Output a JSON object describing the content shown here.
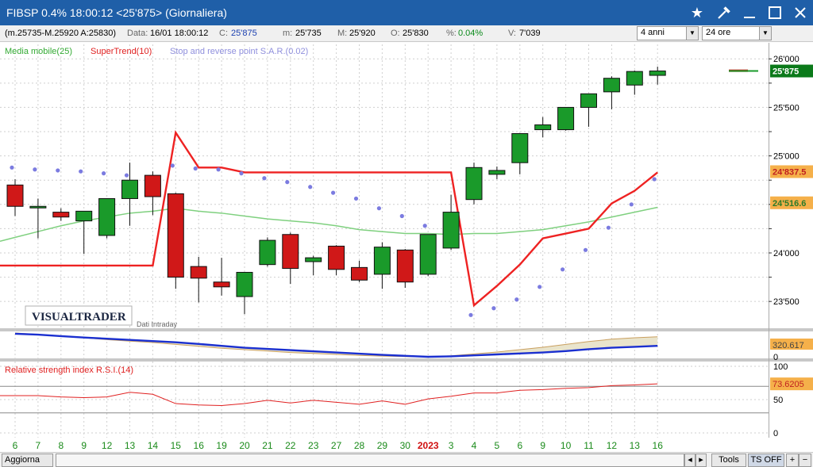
{
  "window": {
    "title": "FIBSP 0.4% 18:00:12  <25'875> (Giornaliera)",
    "icons": [
      "star-icon",
      "tools-icon",
      "minimize-icon",
      "maximize-icon",
      "close-icon"
    ]
  },
  "infobar": {
    "range": "(m.25735-M.25920 A:25830)",
    "data_label": "Data:",
    "data_value": "16/01 18:00:12",
    "close_label": "C:",
    "close_value": "25'875",
    "min_label": "m:",
    "min_value": "25'735",
    "max_label": "M:",
    "max_value": "25'920",
    "open_label": "O:",
    "open_value": "25'830",
    "pct_label": "%:",
    "pct_value": "0.04%",
    "vol_label": "V:",
    "vol_value": "7'039",
    "period_select": "4 anni",
    "interval_select": "24 ore"
  },
  "legend": {
    "ma": "Media mobile(25)",
    "supertrend": "SuperTrend(10)",
    "sar": "Stop and reverse point S.A.R.(0.02)"
  },
  "watermark": {
    "logo": "VISUALTRADER",
    "note": "Dati Intraday"
  },
  "colors": {
    "up": "#1a9a2a",
    "down": "#d01818",
    "ma": "#7fd07f",
    "supertrend": "#ee2222",
    "sar": "#7b7be0",
    "rsi": "#e02020",
    "price_tag": "#0b7a1a",
    "level_tag": "#f5b04a"
  },
  "chart_data": [
    {
      "type": "candlestick",
      "title": "",
      "x": [
        "6",
        "7",
        "8",
        "9",
        "12",
        "13",
        "14",
        "15",
        "16",
        "19",
        "20",
        "21",
        "22",
        "23",
        "27",
        "28",
        "29",
        "30",
        "2023",
        "3",
        "4",
        "5",
        "6",
        "9",
        "10",
        "11",
        "12",
        "13",
        "16"
      ],
      "ohlc": [
        [
          24700,
          24760,
          24380,
          24480
        ],
        [
          24470,
          24560,
          24150,
          24480
        ],
        [
          24420,
          24460,
          24330,
          24370
        ],
        [
          24330,
          24420,
          23990,
          24430
        ],
        [
          24180,
          24560,
          24150,
          24560
        ],
        [
          24560,
          24930,
          24280,
          24750
        ],
        [
          24800,
          24840,
          24390,
          24580
        ],
        [
          24610,
          24620,
          23630,
          23750
        ],
        [
          23860,
          23960,
          23490,
          23740
        ],
        [
          23700,
          23950,
          23560,
          23650
        ],
        [
          23550,
          23800,
          23370,
          23800
        ],
        [
          23880,
          24160,
          23860,
          24130
        ],
        [
          24190,
          24210,
          23680,
          23840
        ],
        [
          23910,
          23970,
          23770,
          23950
        ],
        [
          24070,
          24080,
          23770,
          23830
        ],
        [
          23850,
          23920,
          23700,
          23720
        ],
        [
          23780,
          24110,
          23630,
          24060
        ],
        [
          24030,
          24040,
          23640,
          23700
        ],
        [
          23780,
          24190,
          23760,
          24190
        ],
        [
          24050,
          24600,
          24030,
          24420
        ],
        [
          24550,
          24930,
          24500,
          24880
        ],
        [
          24810,
          24890,
          24760,
          24850
        ],
        [
          24930,
          25230,
          24810,
          25230
        ],
        [
          25270,
          25400,
          25190,
          25320
        ],
        [
          25270,
          25500,
          25260,
          25500
        ],
        [
          25500,
          25640,
          25300,
          25640
        ],
        [
          25660,
          25820,
          25480,
          25800
        ],
        [
          25730,
          25880,
          25630,
          25870
        ],
        [
          25830,
          25920,
          25735,
          25875
        ]
      ],
      "ma25": [
        24160,
        24220,
        24280,
        24330,
        24370,
        24410,
        24430,
        24460,
        24430,
        24410,
        24380,
        24350,
        24330,
        24310,
        24280,
        24240,
        24220,
        24200,
        24200,
        24190,
        24200,
        24200,
        24220,
        24240,
        24280,
        24320,
        24370,
        24420,
        24470
      ],
      "supertrend": [
        23870,
        23870,
        23870,
        23870,
        23870,
        23870,
        23870,
        25240,
        24880,
        24880,
        24830,
        24830,
        24830,
        24830,
        24830,
        24830,
        24830,
        24830,
        24830,
        24830,
        23460,
        23660,
        23880,
        24150,
        24200,
        24250,
        24510,
        24640,
        24830
      ],
      "sar": [
        24880,
        24860,
        24850,
        24840,
        24820,
        24800,
        null,
        24900,
        24870,
        24860,
        24820,
        24770,
        24730,
        24680,
        24620,
        24560,
        24460,
        24380,
        24280,
        null,
        23360,
        23430,
        23520,
        23650,
        23830,
        24030,
        24260,
        24500,
        24760
      ],
      "price_axis": {
        "min": 23240,
        "max": 26100,
        "ticks": [
          "26'000",
          "25'500",
          "25'000",
          "24'000",
          "23'500"
        ]
      },
      "last_price_tag": "25'875",
      "supertrend_tag": "24'837.5",
      "ma_tag": "24'516.6"
    },
    {
      "type": "area",
      "title": "",
      "series": [
        {
          "values": [
            100,
            94,
            88,
            80,
            72,
            66,
            60,
            52,
            44,
            36,
            30,
            24,
            18,
            14,
            10,
            6,
            3,
            1,
            0,
            4,
            12,
            20,
            30,
            40,
            52,
            64,
            74,
            80,
            84
          ]
        },
        {
          "values": [
            97,
            93,
            87,
            81,
            76,
            71,
            66,
            61,
            54,
            46,
            38,
            33,
            28,
            23,
            18,
            13,
            8,
            4,
            0,
            2,
            6,
            10,
            14,
            18,
            24,
            32,
            38,
            42,
            46
          ]
        }
      ],
      "ylim": [
        0,
        100
      ],
      "tick_labels": [
        "0"
      ],
      "value_tag": "320.617"
    },
    {
      "type": "line",
      "title": "Relative strength index R.S.I.(14)",
      "x": [
        "6",
        "7",
        "8",
        "9",
        "12",
        "13",
        "14",
        "15",
        "16",
        "19",
        "20",
        "21",
        "22",
        "23",
        "27",
        "28",
        "29",
        "30",
        "2023",
        "3",
        "4",
        "5",
        "6",
        "9",
        "10",
        "11",
        "12",
        "13",
        "16"
      ],
      "series": [
        {
          "name": "Relative strength index R.S.I.(14)",
          "values": [
            56,
            56,
            54,
            53,
            54,
            61,
            58,
            44,
            42,
            41,
            44,
            49,
            45,
            49,
            46,
            43,
            48,
            43,
            51,
            55,
            60,
            60,
            64,
            65,
            67,
            68,
            71,
            72,
            73.62
          ]
        }
      ],
      "ylim": [
        0,
        100
      ],
      "tick_labels": [
        "100",
        "50",
        "0"
      ],
      "value_tag": "73.6205"
    }
  ],
  "bottombar": {
    "update": "Aggiorna",
    "tools": "Tools",
    "tsoff": "TS OFF",
    "plus": "+",
    "minus": "−"
  }
}
